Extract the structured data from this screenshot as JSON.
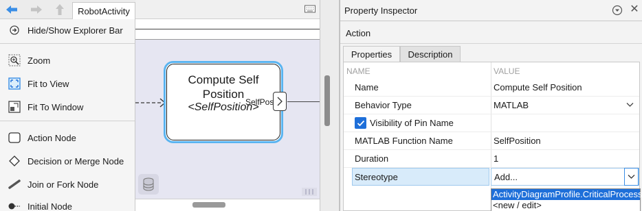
{
  "left_panel": {
    "breadcrumb": "RobotActivity",
    "items": [
      {
        "label": "Hide/Show Explorer Bar",
        "icon": "explorer-bar-icon"
      },
      {
        "label": "Zoom",
        "icon": "zoom-icon"
      },
      {
        "label": "Fit to View",
        "icon": "fit-to-view-icon"
      },
      {
        "label": "Fit To Window",
        "icon": "fit-to-window-icon"
      },
      {
        "label": "Action Node",
        "icon": "action-node-icon"
      },
      {
        "label": "Decision or Merge Node",
        "icon": "decision-node-icon"
      },
      {
        "label": "Join or Fork Node",
        "icon": "join-fork-icon"
      },
      {
        "label": "Initial Node",
        "icon": "initial-node-icon"
      }
    ]
  },
  "canvas": {
    "node_title": "Compute Self Position",
    "node_function": "<SelfPosition>",
    "pin_label": "SelfPos",
    "accent_color": "#5ab4f0"
  },
  "inspector": {
    "title": "Property Inspector",
    "subtitle": "Action",
    "tabs": [
      "Properties",
      "Description"
    ],
    "columns": {
      "name": "NAME",
      "value": "VALUE"
    },
    "rows": {
      "name": {
        "name": "Name",
        "value": "Compute Self Position"
      },
      "behavior_type": {
        "name": "Behavior Type",
        "value": "MATLAB"
      },
      "visibility": {
        "label": "Visibility of Pin Name",
        "checked": true
      },
      "function_name": {
        "name": "MATLAB Function Name",
        "value": "SelfPosition"
      },
      "duration": {
        "name": "Duration",
        "value": "1"
      },
      "stereotype": {
        "name": "Stereotype",
        "value": "Add..."
      }
    },
    "stereotype_options": [
      "ActivityDiagramProfile.CriticalProcess",
      "<new / edit>"
    ],
    "selection_color": "#1e6fd9"
  }
}
